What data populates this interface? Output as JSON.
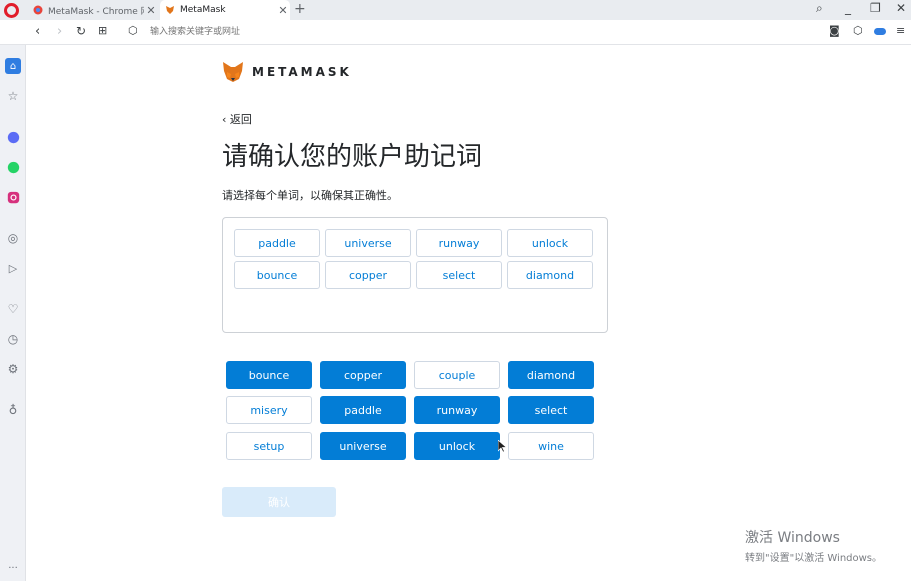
{
  "browser": {
    "tabs": [
      {
        "title": "MetaMask - Chrome 网上",
        "active": false
      },
      {
        "title": "MetaMask",
        "active": true
      }
    ],
    "new_tab": "+",
    "address_placeholder": "输入搜索关键字或网址"
  },
  "page": {
    "logo_text": "METAMASK",
    "back_label": "返回",
    "heading": "请确认您的账户助记词",
    "subtext": "请选择每个单词，以确保其正确性。",
    "selected_words": [
      "paddle",
      "universe",
      "runway",
      "unlock",
      "bounce",
      "copper",
      "select",
      "diamond"
    ],
    "word_pool": [
      {
        "word": "bounce",
        "selected": true
      },
      {
        "word": "copper",
        "selected": true
      },
      {
        "word": "couple",
        "selected": false
      },
      {
        "word": "diamond",
        "selected": true
      },
      {
        "word": "misery",
        "selected": false
      },
      {
        "word": "paddle",
        "selected": true
      },
      {
        "word": "runway",
        "selected": true
      },
      {
        "word": "select",
        "selected": true
      },
      {
        "word": "setup",
        "selected": false
      },
      {
        "word": "universe",
        "selected": true
      },
      {
        "word": "unlock",
        "selected": true
      },
      {
        "word": "wine",
        "selected": false
      }
    ],
    "confirm_label": "确认"
  },
  "watermark": {
    "line1": "激活 Windows",
    "line2": "转到\"设置\"以激活 Windows。"
  },
  "colors": {
    "accent": "#037dd6",
    "confirm_disabled": "#d9ebfa"
  }
}
